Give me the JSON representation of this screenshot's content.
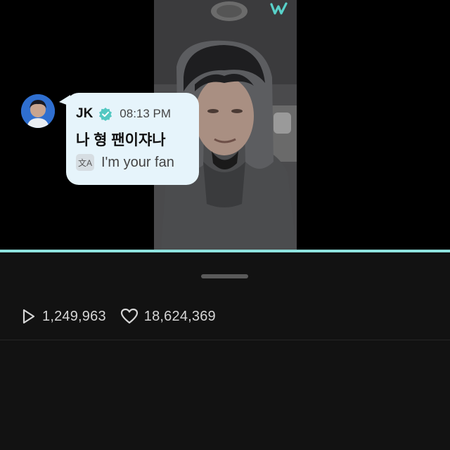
{
  "player": {
    "progress_percent": 100,
    "logo_icon": "weverse-w-icon"
  },
  "stats": {
    "views": "1,249,963",
    "views_icon": "play-icon",
    "likes": "18,624,369",
    "likes_icon": "heart-icon"
  },
  "comment": {
    "author": "JK",
    "verified_icon": "verified-badge-icon",
    "time": "08:13 PM",
    "text": "나 형 팬이쟈나",
    "translate_icon": "translate-icon",
    "translate_icon_glyph": "文A",
    "translation": "I'm your fan"
  },
  "colors": {
    "accent": "#8fe3df",
    "panel_bg": "#121212",
    "bubble_bg": "#e6f4fb"
  }
}
